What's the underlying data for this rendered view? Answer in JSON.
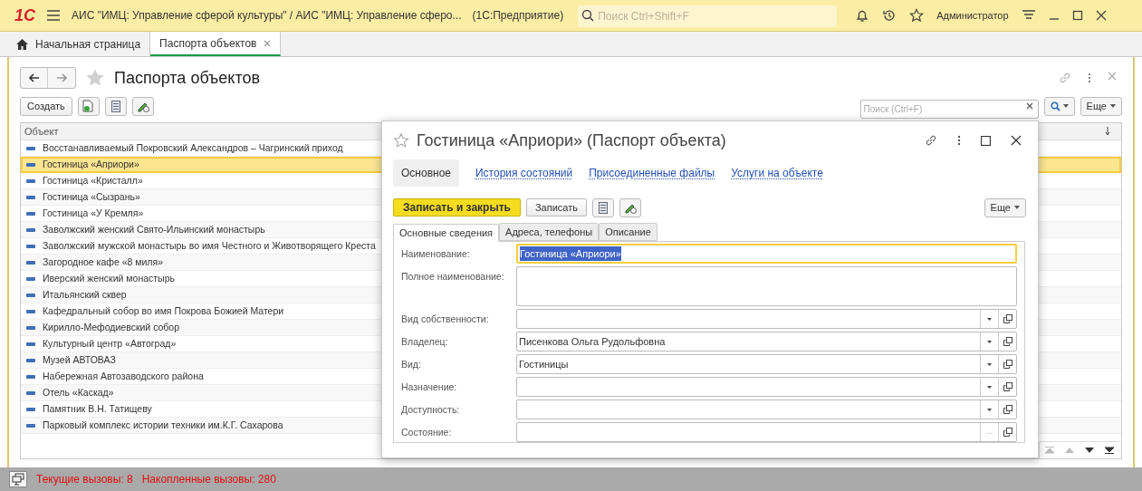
{
  "window": {
    "logo": "1С",
    "title": "АИС \"ИМЦ: Управление сферой культуры\" / АИС \"ИМЦ: Управление сферо...",
    "app": "(1С:Предприятие)",
    "search_placeholder": "Поиск Ctrl+Shift+F",
    "user": "Администратор"
  },
  "tabs": [
    {
      "label": "Начальная страница",
      "selected": false,
      "home": true
    },
    {
      "label": "Паспорта объектов",
      "selected": true,
      "home": false
    }
  ],
  "list_form": {
    "title": "Паспорта объектов",
    "create_button": "Создать",
    "search_placeholder": "Поиск (Ctrl+F)",
    "more_button": "Еще",
    "column": "Объект",
    "rows": [
      {
        "text": "Восстанавливаемый Покровский Александров – Чагринский приход",
        "selected": false
      },
      {
        "text": "Гостиница «Априори»",
        "selected": true
      },
      {
        "text": "Гостиница «Кристалл»",
        "selected": false
      },
      {
        "text": "Гостиница «Сызрань»",
        "selected": false
      },
      {
        "text": "Гостиница «У Кремля»",
        "selected": false
      },
      {
        "text": "Заволжский женский Свято-Ильинский монастырь",
        "selected": false
      },
      {
        "text": "Заволжский мужской монастырь во имя Честного и Животворящего Креста",
        "selected": false
      },
      {
        "text": "Загородное кафе «8 миля»",
        "selected": false
      },
      {
        "text": "Иверский женский монастырь",
        "selected": false
      },
      {
        "text": "Итальянский сквер",
        "selected": false
      },
      {
        "text": "Кафедральный собор во имя Покрова Божией Матери",
        "selected": false
      },
      {
        "text": "Кирилло-Мефодиевский собор",
        "selected": false
      },
      {
        "text": "Культурный центр «Автоград»",
        "selected": false
      },
      {
        "text": "Музей АВТОВАЗ",
        "selected": false
      },
      {
        "text": "Набережная Автозаводского района",
        "selected": false
      },
      {
        "text": "Отель «Каскад»",
        "selected": false
      },
      {
        "text": "Памятник В.Н. Татищеву",
        "selected": false
      },
      {
        "text": "Парковый комплекс истории техники им.К.Г. Сахарова",
        "selected": false
      }
    ]
  },
  "dialog": {
    "title": "Гостиница «Априори» (Паспорт объекта)",
    "sections": [
      {
        "label": "Основное",
        "selected": true
      },
      {
        "label": "История состояний",
        "selected": false
      },
      {
        "label": "Присоединенные файлы",
        "selected": false
      },
      {
        "label": "Услуги на объекте",
        "selected": false
      }
    ],
    "save_close_button": "Записать и закрыть",
    "save_button": "Записать",
    "more_button": "Еще",
    "tabs": [
      {
        "label": "Основные сведения",
        "selected": true
      },
      {
        "label": "Адреса, телефоны",
        "selected": false
      },
      {
        "label": "Описание",
        "selected": false
      }
    ],
    "fields": [
      {
        "label": "Наименование:",
        "kind": "input",
        "value": "Гостиница «Априори»",
        "focused": true
      },
      {
        "label": "Полное наименование:",
        "kind": "textarea",
        "focused": false
      },
      {
        "label": "Вид собственности:",
        "kind": "choice",
        "focused": false
      },
      {
        "label": "Владелец:",
        "kind": "choice",
        "value": "Писенкова Ольга Рудольфовна",
        "focused": false
      },
      {
        "label": "Вид:",
        "kind": "choice",
        "value": "Гостиницы",
        "focused": false
      },
      {
        "label": "Назначение:",
        "kind": "choice",
        "focused": false
      },
      {
        "label": "Доступность:",
        "kind": "choice",
        "focused": false
      },
      {
        "label": "Состояние:",
        "kind": "pick",
        "button_text": "...",
        "focused": false
      }
    ]
  },
  "status_bar": {
    "current_calls": "Текущие вызовы: 8",
    "total_calls": "Накопленные вызовы: 280"
  }
}
